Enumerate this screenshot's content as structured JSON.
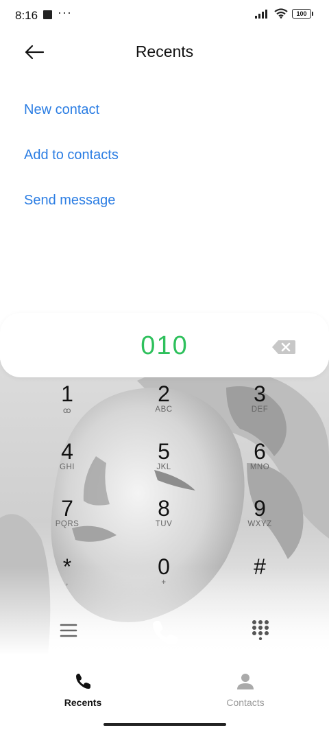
{
  "status_bar": {
    "time": "8:16",
    "dots": "···",
    "battery": "100"
  },
  "header": {
    "title": "Recents",
    "back_icon": "arrow-left-icon"
  },
  "actions": [
    {
      "label": "New contact"
    },
    {
      "label": "Add to contacts"
    },
    {
      "label": "Send message"
    }
  ],
  "dialer": {
    "number": "010",
    "number_color": "#2ec05c",
    "keys": [
      {
        "digit": "1",
        "letters": "ꝏ"
      },
      {
        "digit": "2",
        "letters": "ABC"
      },
      {
        "digit": "3",
        "letters": "DEF"
      },
      {
        "digit": "4",
        "letters": "GHI"
      },
      {
        "digit": "5",
        "letters": "JKL"
      },
      {
        "digit": "6",
        "letters": "MNO"
      },
      {
        "digit": "7",
        "letters": "PQRS"
      },
      {
        "digit": "8",
        "letters": "TUV"
      },
      {
        "digit": "9",
        "letters": "WXYZ"
      },
      {
        "digit": "*",
        "letters": ","
      },
      {
        "digit": "0",
        "letters": "+"
      },
      {
        "digit": "#",
        "letters": ""
      }
    ]
  },
  "bottom_nav": {
    "tabs": [
      {
        "label": "Recents",
        "icon": "phone-icon",
        "active": true
      },
      {
        "label": "Contacts",
        "icon": "person-icon",
        "active": false
      }
    ]
  },
  "colors": {
    "accent_link": "#2b7de3",
    "number": "#2ec05c"
  }
}
